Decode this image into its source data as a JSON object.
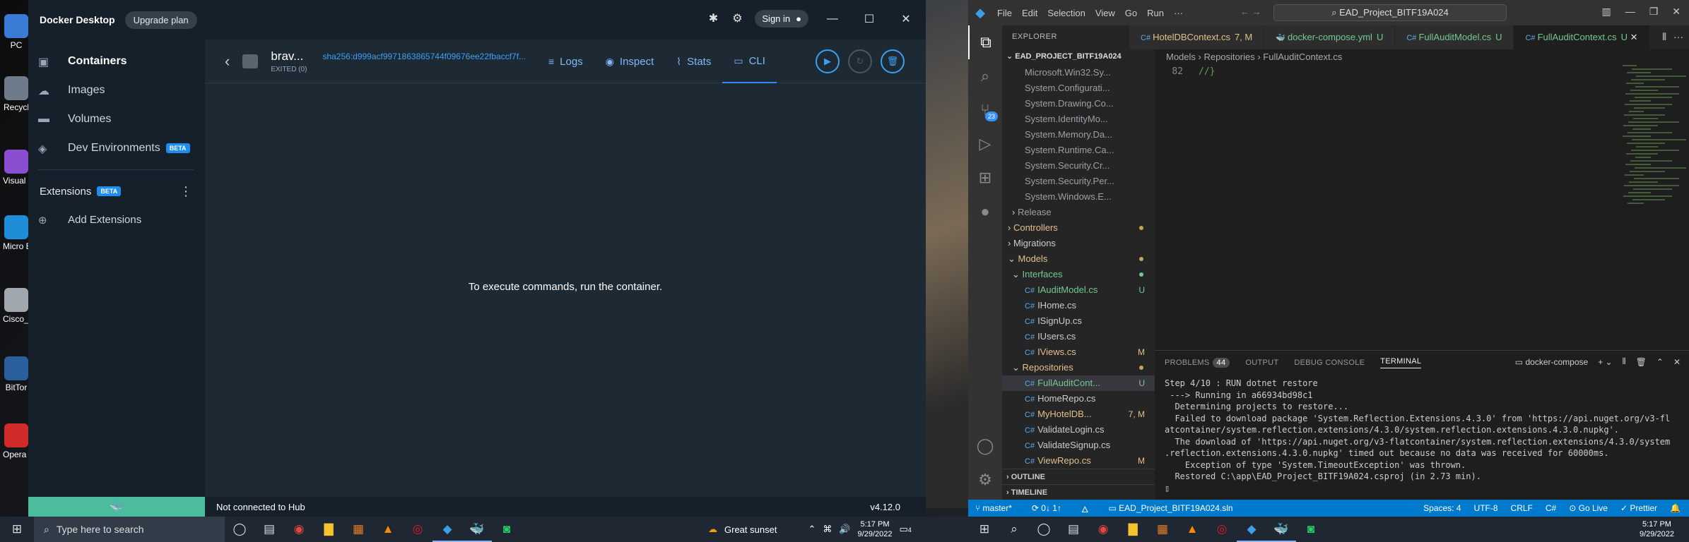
{
  "docker": {
    "app_name": "Docker Desktop",
    "upgrade_label": "Upgrade plan",
    "sign_in_label": "Sign in",
    "sidebar": {
      "items": [
        {
          "label": "Containers"
        },
        {
          "label": "Images"
        },
        {
          "label": "Volumes"
        },
        {
          "label": "Dev Environments",
          "badge": "BETA"
        }
      ],
      "extensions_label": "Extensions",
      "extensions_badge": "BETA",
      "add_extensions_label": "Add Extensions"
    },
    "container": {
      "name": "brav...",
      "sha": "sha256:d999acf9971863865744f09676ee22fbaccf7f...",
      "status": "EXITED (0)"
    },
    "tabs": [
      {
        "label": "Logs",
        "icon": "list-icon"
      },
      {
        "label": "Inspect",
        "icon": "eye-icon"
      },
      {
        "label": "Stats",
        "icon": "chart-icon"
      },
      {
        "label": "CLI",
        "icon": "terminal-icon"
      }
    ],
    "empty_message": "To execute commands, run the container.",
    "status_hub": "Not connected to Hub",
    "version": "v4.12.0"
  },
  "desktop_icons": [
    {
      "label": "PC",
      "color": "#3a7bd5"
    },
    {
      "label": "Recycl",
      "color": "#6d7b8a"
    },
    {
      "label": "Visual S Insta",
      "color": "#8a4fd1"
    },
    {
      "label": "Micro Edg",
      "color": "#1f8ed9"
    },
    {
      "label": "Cisco_P",
      "color": "#a0a7af"
    },
    {
      "label": "BitTor",
      "color": "#2a5f9e"
    },
    {
      "label": "Opera Brow",
      "color": "#d12a2a"
    }
  ],
  "vscode": {
    "menu": [
      "File",
      "Edit",
      "Selection",
      "View",
      "Go",
      "Run",
      "···"
    ],
    "search": "EAD_Project_BITF19A024",
    "explorer_title": "EXPLORER",
    "root": "EAD_PROJECT_BITF19A024",
    "tree": [
      {
        "label": "Microsoft.Win32.Sy...",
        "indent": 28,
        "color": "#9aa0a6"
      },
      {
        "label": "System.Configurati...",
        "indent": 28,
        "color": "#9aa0a6"
      },
      {
        "label": "System.Drawing.Co...",
        "indent": 28,
        "color": "#9aa0a6"
      },
      {
        "label": "System.IdentityMo...",
        "indent": 28,
        "color": "#9aa0a6"
      },
      {
        "label": "System.Memory.Da...",
        "indent": 28,
        "color": "#9aa0a6"
      },
      {
        "label": "System.Runtime.Ca...",
        "indent": 28,
        "color": "#9aa0a6"
      },
      {
        "label": "System.Security.Cr...",
        "indent": 28,
        "color": "#9aa0a6"
      },
      {
        "label": "System.Security.Per...",
        "indent": 28,
        "color": "#9aa0a6"
      },
      {
        "label": "System.Windows.E...",
        "indent": 28,
        "color": "#9aa0a6"
      },
      {
        "label": "Release",
        "indent": 10,
        "color": "#9aa0a6",
        "folder": "›"
      },
      {
        "label": "Controllers",
        "indent": 4,
        "color": "#e2c08d",
        "folder": "›",
        "dot": "#c6a35a"
      },
      {
        "label": "Migrations",
        "indent": 4,
        "color": "#ccc",
        "folder": "›"
      },
      {
        "label": "Models",
        "indent": 4,
        "color": "#e2c08d",
        "folder": "⌄",
        "dot": "#c6a35a"
      },
      {
        "label": "Interfaces",
        "indent": 10,
        "color": "#73c991",
        "folder": "⌄",
        "dot": "#73c991"
      },
      {
        "label": "IAuditModel.cs",
        "indent": 28,
        "color": "#73c991",
        "cs": true,
        "mark": "U"
      },
      {
        "label": "IHome.cs",
        "indent": 28,
        "color": "#ccc",
        "cs": true
      },
      {
        "label": "ISignUp.cs",
        "indent": 28,
        "color": "#ccc",
        "cs": true
      },
      {
        "label": "IUsers.cs",
        "indent": 28,
        "color": "#ccc",
        "cs": true
      },
      {
        "label": "IViews.cs",
        "indent": 28,
        "color": "#e2c08d",
        "cs": true,
        "mark": "M"
      },
      {
        "label": "Repositories",
        "indent": 10,
        "color": "#e2c08d",
        "folder": "⌄",
        "dot": "#c6a35a"
      },
      {
        "label": "FullAuditCont...",
        "indent": 28,
        "color": "#73c991",
        "cs": true,
        "mark": "U",
        "selected": true
      },
      {
        "label": "HomeRepo.cs",
        "indent": 28,
        "color": "#ccc",
        "cs": true
      },
      {
        "label": "MyHotelDB...",
        "indent": 28,
        "color": "#e2c08d",
        "cs": true,
        "mark": "7, M"
      },
      {
        "label": "ValidateLogin.cs",
        "indent": 28,
        "color": "#ccc",
        "cs": true
      },
      {
        "label": "ValidateSignup.cs",
        "indent": 28,
        "color": "#ccc",
        "cs": true
      },
      {
        "label": "ViewRepo.cs",
        "indent": 28,
        "color": "#e2c08d",
        "cs": true,
        "mark": "M"
      }
    ],
    "outline_label": "OUTLINE",
    "timeline_label": "TIMELINE",
    "tabs": [
      {
        "label": "HotelDBContext.cs",
        "suffix": "7, M",
        "active": false
      },
      {
        "label": "docker-compose.yml",
        "suffix": "U",
        "active": false
      },
      {
        "label": "FullAuditModel.cs",
        "suffix": "U",
        "active": false
      },
      {
        "label": "FullAuditContext.cs",
        "suffix": "U",
        "active": true
      }
    ],
    "breadcrumb": "Models › Repositories › FullAuditContext.cs",
    "code": [
      {
        "num": "82",
        "text": "//}"
      }
    ],
    "panel": {
      "tabs": [
        "PROBLEMS",
        "OUTPUT",
        "DEBUG CONSOLE",
        "TERMINAL"
      ],
      "problems_count": "44",
      "terminal_name": "docker-compose",
      "lines": [
        "Step 4/10 : RUN dotnet restore",
        " ---> Running in a66934bd98c1",
        "  Determining projects to restore...",
        "  Failed to download package 'System.Reflection.Extensions.4.3.0' from 'https://api.nuget.org/v3-fl",
        "atcontainer/system.reflection.extensions/4.3.0/system.reflection.extensions.4.3.0.nupkg'.",
        "  The download of 'https://api.nuget.org/v3-flatcontainer/system.reflection.extensions/4.3.0/system",
        ".reflection.extensions.4.3.0.nupkg' timed out because no data was received for 60000ms.",
        "    Exception of type 'System.TimeoutException' was thrown.",
        "  Restored C:\\app\\EAD_Project_BITF19A024.csproj (in 2.73 min).",
        "▯"
      ]
    },
    "status": {
      "branch": "master*",
      "sync": "⟳ 0↓ 1↑",
      "solution": "EAD_Project_BITF19A024.sln",
      "spaces": "Spaces: 4",
      "encoding": "UTF-8",
      "eol": "CRLF",
      "lang": "C#",
      "golive": "Go Live",
      "prettier": "✓ Prettier"
    },
    "activity_badge": "23"
  },
  "taskbar": {
    "search_placeholder": "Type here to search",
    "weather": "Great sunset",
    "time_left": "5:17 PM",
    "date_left": "9/29/2022",
    "time_right": "5:17 PM",
    "date_right": "9/29/2022",
    "notif_count": "4"
  }
}
